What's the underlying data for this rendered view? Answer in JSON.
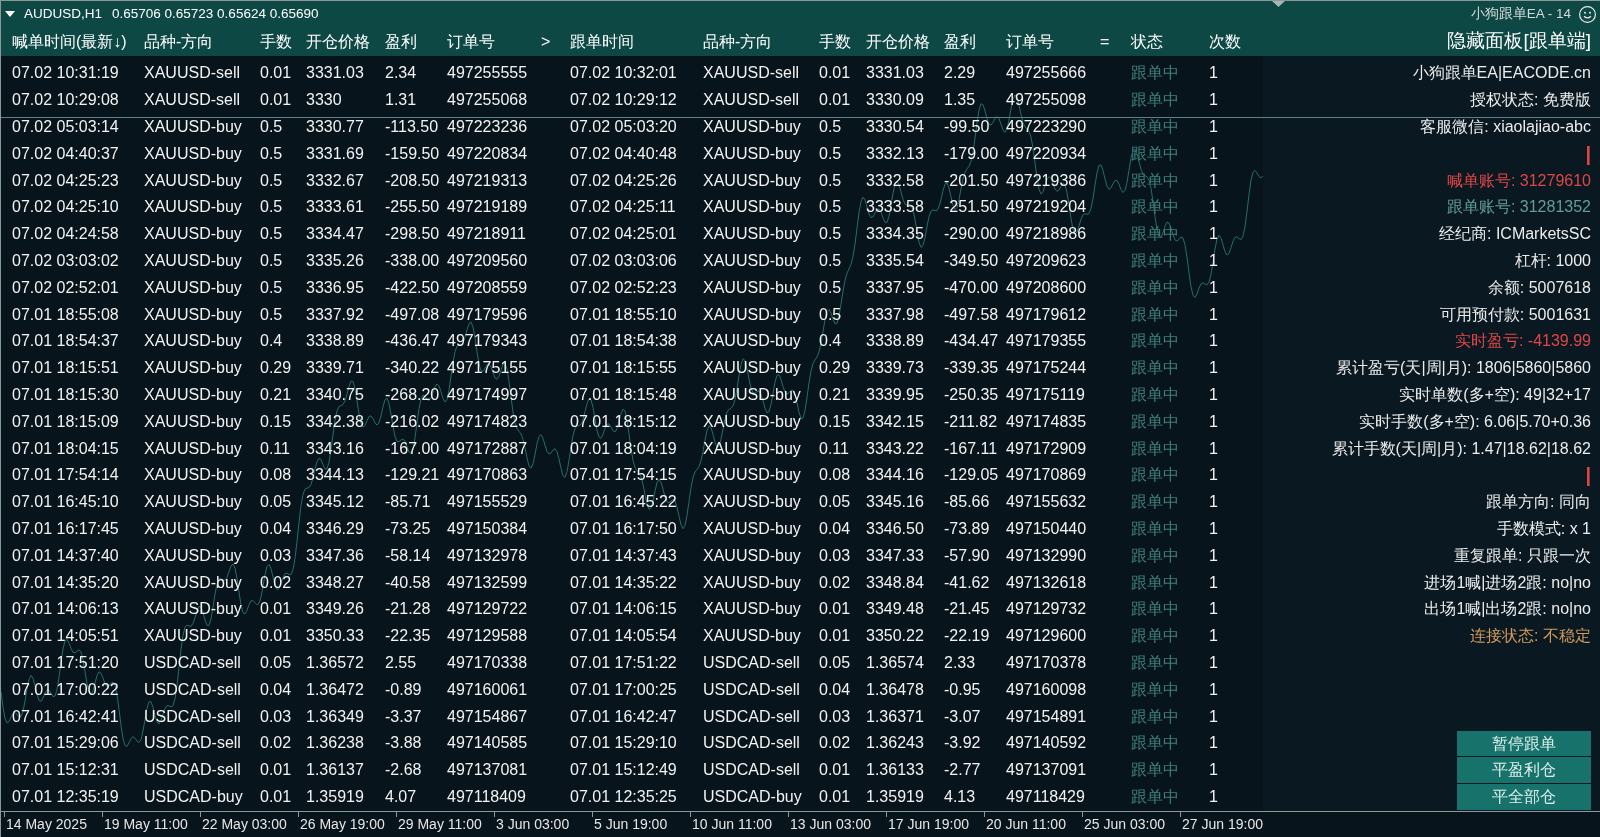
{
  "chart_header": {
    "symbol": "AUDUSD,H1",
    "prices": "0.65706 0.65723 0.65624 0.65690",
    "expert": "小狗跟单EA - 14"
  },
  "table": {
    "columns": [
      {
        "label": "喊单时间(最新↓)"
      },
      {
        "label": "品种-方向"
      },
      {
        "label": "手数"
      },
      {
        "label": "开仓价格"
      },
      {
        "label": "盈利"
      },
      {
        "label": "订单号",
        "sign": ">"
      },
      {
        "label": "跟单时间"
      },
      {
        "label": "品种-方向"
      },
      {
        "label": "手数"
      },
      {
        "label": "开仓价格"
      },
      {
        "label": "盈利"
      },
      {
        "label": "订单号",
        "sign": "="
      },
      {
        "label": "状态"
      },
      {
        "label": "次数"
      }
    ],
    "rows": [
      [
        "07.02 10:31:19",
        "XAUUSD-sell",
        "0.01",
        "3331.03",
        "2.34",
        "497255555",
        "07.02 10:32:01",
        "XAUUSD-sell",
        "0.01",
        "3331.03",
        "2.29",
        "497255666",
        "跟单中",
        "1"
      ],
      [
        "07.02 10:29:08",
        "XAUUSD-sell",
        "0.01",
        "3330",
        "1.31",
        "497255068",
        "07.02 10:29:12",
        "XAUUSD-sell",
        "0.01",
        "3330.09",
        "1.35",
        "497255098",
        "跟单中",
        "1"
      ],
      [
        "07.02 05:03:14",
        "XAUUSD-buy",
        "0.5",
        "3330.77",
        "-113.50",
        "497223236",
        "07.02 05:03:20",
        "XAUUSD-buy",
        "0.5",
        "3330.54",
        "-99.50",
        "497223290",
        "跟单中",
        "1"
      ],
      [
        "07.02 04:40:37",
        "XAUUSD-buy",
        "0.5",
        "3331.69",
        "-159.50",
        "497220834",
        "07.02 04:40:48",
        "XAUUSD-buy",
        "0.5",
        "3332.13",
        "-179.00",
        "497220934",
        "跟单中",
        "1"
      ],
      [
        "07.02 04:25:23",
        "XAUUSD-buy",
        "0.5",
        "3332.67",
        "-208.50",
        "497219313",
        "07.02 04:25:26",
        "XAUUSD-buy",
        "0.5",
        "3332.58",
        "-201.50",
        "497219386",
        "跟单中",
        "1"
      ],
      [
        "07.02 04:25:10",
        "XAUUSD-buy",
        "0.5",
        "3333.61",
        "-255.50",
        "497219189",
        "07.02 04:25:11",
        "XAUUSD-buy",
        "0.5",
        "3333.58",
        "-251.50",
        "497219204",
        "跟单中",
        "1"
      ],
      [
        "07.02 04:24:58",
        "XAUUSD-buy",
        "0.5",
        "3334.47",
        "-298.50",
        "497218911",
        "07.02 04:25:01",
        "XAUUSD-buy",
        "0.5",
        "3334.35",
        "-290.00",
        "497218986",
        "跟单中",
        "1"
      ],
      [
        "07.02 03:03:02",
        "XAUUSD-buy",
        "0.5",
        "3335.26",
        "-338.00",
        "497209560",
        "07.02 03:03:06",
        "XAUUSD-buy",
        "0.5",
        "3335.54",
        "-349.50",
        "497209623",
        "跟单中",
        "1"
      ],
      [
        "07.02 02:52:01",
        "XAUUSD-buy",
        "0.5",
        "3336.95",
        "-422.50",
        "497208559",
        "07.02 02:52:23",
        "XAUUSD-buy",
        "0.5",
        "3337.95",
        "-470.00",
        "497208600",
        "跟单中",
        "1"
      ],
      [
        "07.01 18:55:08",
        "XAUUSD-buy",
        "0.5",
        "3337.92",
        "-497.08",
        "497179596",
        "07.01 18:55:10",
        "XAUUSD-buy",
        "0.5",
        "3337.98",
        "-497.58",
        "497179612",
        "跟单中",
        "1"
      ],
      [
        "07.01 18:54:37",
        "XAUUSD-buy",
        "0.4",
        "3338.89",
        "-436.47",
        "497179343",
        "07.01 18:54:38",
        "XAUUSD-buy",
        "0.4",
        "3338.89",
        "-434.47",
        "497179355",
        "跟单中",
        "1"
      ],
      [
        "07.01 18:15:51",
        "XAUUSD-buy",
        "0.29",
        "3339.71",
        "-340.22",
        "497175155",
        "07.01 18:15:55",
        "XAUUSD-buy",
        "0.29",
        "3339.73",
        "-339.35",
        "497175244",
        "跟单中",
        "1"
      ],
      [
        "07.01 18:15:30",
        "XAUUSD-buy",
        "0.21",
        "3340.75",
        "-268.20",
        "497174997",
        "07.01 18:15:48",
        "XAUUSD-buy",
        "0.21",
        "3339.95",
        "-250.35",
        "497175119",
        "跟单中",
        "1"
      ],
      [
        "07.01 18:15:09",
        "XAUUSD-buy",
        "0.15",
        "3342.38",
        "-216.02",
        "497174823",
        "07.01 18:15:12",
        "XAUUSD-buy",
        "0.15",
        "3342.15",
        "-211.82",
        "497174835",
        "跟单中",
        "1"
      ],
      [
        "07.01 18:04:15",
        "XAUUSD-buy",
        "0.11",
        "3343.16",
        "-167.00",
        "497172887",
        "07.01 18:04:19",
        "XAUUSD-buy",
        "0.11",
        "3343.22",
        "-167.11",
        "497172909",
        "跟单中",
        "1"
      ],
      [
        "07.01 17:54:14",
        "XAUUSD-buy",
        "0.08",
        "3344.13",
        "-129.21",
        "497170863",
        "07.01 17:54:15",
        "XAUUSD-buy",
        "0.08",
        "3344.16",
        "-129.05",
        "497170869",
        "跟单中",
        "1"
      ],
      [
        "07.01 16:45:10",
        "XAUUSD-buy",
        "0.05",
        "3345.12",
        "-85.71",
        "497155529",
        "07.01 16:45:22",
        "XAUUSD-buy",
        "0.05",
        "3345.16",
        "-85.66",
        "497155632",
        "跟单中",
        "1"
      ],
      [
        "07.01 16:17:45",
        "XAUUSD-buy",
        "0.04",
        "3346.29",
        "-73.25",
        "497150384",
        "07.01 16:17:50",
        "XAUUSD-buy",
        "0.04",
        "3346.50",
        "-73.89",
        "497150440",
        "跟单中",
        "1"
      ],
      [
        "07.01 14:37:40",
        "XAUUSD-buy",
        "0.03",
        "3347.36",
        "-58.14",
        "497132978",
        "07.01 14:37:43",
        "XAUUSD-buy",
        "0.03",
        "3347.33",
        "-57.90",
        "497132990",
        "跟单中",
        "1"
      ],
      [
        "07.01 14:35:20",
        "XAUUSD-buy",
        "0.02",
        "3348.27",
        "-40.58",
        "497132599",
        "07.01 14:35:22",
        "XAUUSD-buy",
        "0.02",
        "3348.84",
        "-41.62",
        "497132618",
        "跟单中",
        "1"
      ],
      [
        "07.01 14:06:13",
        "XAUUSD-buy",
        "0.01",
        "3349.26",
        "-21.28",
        "497129722",
        "07.01 14:06:15",
        "XAUUSD-buy",
        "0.01",
        "3349.48",
        "-21.45",
        "497129732",
        "跟单中",
        "1"
      ],
      [
        "07.01 14:05:51",
        "XAUUSD-buy",
        "0.01",
        "3350.33",
        "-22.35",
        "497129588",
        "07.01 14:05:54",
        "XAUUSD-buy",
        "0.01",
        "3350.22",
        "-22.19",
        "497129600",
        "跟单中",
        "1"
      ],
      [
        "07.01 17:51:20",
        "USDCAD-sell",
        "0.05",
        "1.36572",
        "2.55",
        "497170338",
        "07.01 17:51:22",
        "USDCAD-sell",
        "0.05",
        "1.36574",
        "2.33",
        "497170378",
        "跟单中",
        "1"
      ],
      [
        "07.01 17:00:22",
        "USDCAD-sell",
        "0.04",
        "1.36472",
        "-0.89",
        "497160061",
        "07.01 17:00:25",
        "USDCAD-sell",
        "0.04",
        "1.36478",
        "-0.95",
        "497160098",
        "跟单中",
        "1"
      ],
      [
        "07.01 16:42:41",
        "USDCAD-sell",
        "0.03",
        "1.36349",
        "-3.37",
        "497154867",
        "07.01 16:42:47",
        "USDCAD-sell",
        "0.03",
        "1.36371",
        "-3.07",
        "497154891",
        "跟单中",
        "1"
      ],
      [
        "07.01 15:29:06",
        "USDCAD-sell",
        "0.02",
        "1.36238",
        "-3.88",
        "497140585",
        "07.01 15:29:10",
        "USDCAD-sell",
        "0.02",
        "1.36243",
        "-3.92",
        "497140592",
        "跟单中",
        "1"
      ],
      [
        "07.01 15:12:31",
        "USDCAD-sell",
        "0.01",
        "1.36137",
        "-2.68",
        "497137081",
        "07.01 15:12:49",
        "USDCAD-sell",
        "0.01",
        "1.36133",
        "-2.77",
        "497137091",
        "跟单中",
        "1"
      ],
      [
        "07.01 12:35:19",
        "USDCAD-buy",
        "0.01",
        "1.35919",
        "4.07",
        "497118409",
        "07.01 12:35:25",
        "USDCAD-buy",
        "0.01",
        "1.35919",
        "4.13",
        "497118429",
        "跟单中",
        "1"
      ]
    ]
  },
  "panel": {
    "toggle": "隐藏面板[跟单端]",
    "lines": [
      {
        "kind": "text",
        "text": "小狗跟单EA|EACODE.cn",
        "color": "#ececec"
      },
      {
        "kind": "text",
        "text": "授权状态: 免费版",
        "color": "#ececec"
      },
      {
        "kind": "text",
        "text": "客服微信: xiaolajiao-abc",
        "color": "#ececec"
      },
      {
        "kind": "separator",
        "text": "|",
        "color": "#e04646"
      },
      {
        "kind": "text",
        "text": "喊单账号: 31279610",
        "color": "#e04646"
      },
      {
        "kind": "text",
        "text": "跟单账号: 31281352",
        "color": "#5f9e9c"
      },
      {
        "kind": "text",
        "text": "经纪商: ICMarketsSC",
        "color": "#ececec"
      },
      {
        "kind": "text",
        "text": "杠杆: 1000",
        "color": "#ececec"
      },
      {
        "kind": "text",
        "text": "余额: 5007618",
        "color": "#ececec"
      },
      {
        "kind": "text",
        "text": "可用预付款: 5001631",
        "color": "#ececec"
      },
      {
        "kind": "text",
        "text": "实时盈亏: -4139.99",
        "color": "#e04646"
      },
      {
        "kind": "text",
        "text": "累计盈亏(天|周|月): 1806|5860|5860",
        "color": "#ececec"
      },
      {
        "kind": "text",
        "text": "实时单数(多+空): 49|32+17",
        "color": "#ececec"
      },
      {
        "kind": "text",
        "text": "实时手数(多+空): 6.06|5.70+0.36",
        "color": "#ececec"
      },
      {
        "kind": "text",
        "text": "累计手数(天|周|月): 1.47|18.62|18.62",
        "color": "#ececec"
      },
      {
        "kind": "separator",
        "text": "|",
        "color": "#e04646"
      },
      {
        "kind": "text",
        "text": "跟单方向: 同向",
        "color": "#ececec"
      },
      {
        "kind": "text",
        "text": "手数模式: x 1",
        "color": "#ececec"
      },
      {
        "kind": "text",
        "text": "重复跟单: 只跟一次",
        "color": "#ececec"
      },
      {
        "kind": "text",
        "text": "进场1喊|进场2跟: no|no",
        "color": "#ececec"
      },
      {
        "kind": "text",
        "text": "出场1喊|出场2跟: no|no",
        "color": "#ececec"
      },
      {
        "kind": "text",
        "text": "连接状态: 不稳定",
        "color": "#d19a5c"
      }
    ],
    "buttons": [
      "暂停跟单",
      "平盈利仓",
      "平全部仓"
    ]
  },
  "time_axis": {
    "labels": [
      "14 May 2025",
      "19 May 11:00",
      "22 May 03:00",
      "26 May 19:00",
      "29 May 11:00",
      "3 Jun 03:00",
      "5 Jun 19:00",
      "10 Jun 11:00",
      "13 Jun 03:00",
      "17 Jun 19:00",
      "20 Jun 11:00",
      "25 Jun 03:00",
      "27 Jun 19:00"
    ]
  }
}
